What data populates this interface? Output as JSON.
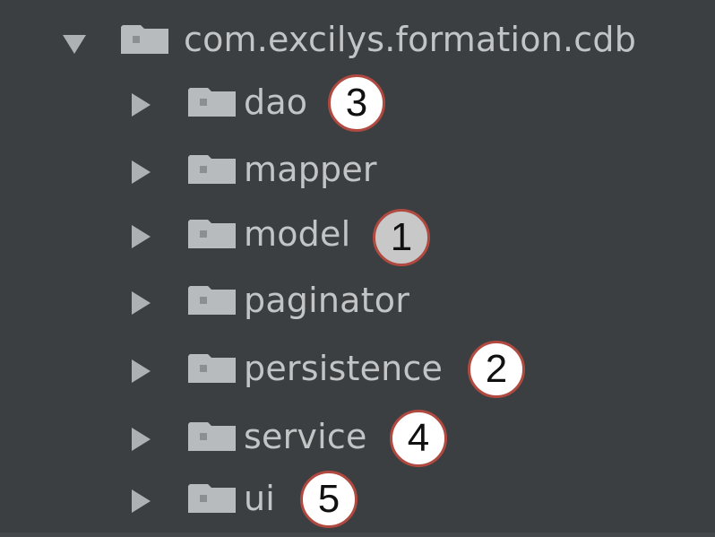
{
  "tree": {
    "root": {
      "label": "com.excilys.formation.cdb",
      "expanded": true,
      "icon": "folder-icon"
    },
    "children": [
      {
        "label": "dao",
        "expanded": false,
        "icon": "folder-icon",
        "annotation": "3"
      },
      {
        "label": "mapper",
        "expanded": false,
        "icon": "folder-icon",
        "annotation": ""
      },
      {
        "label": "model",
        "expanded": false,
        "icon": "folder-icon",
        "annotation": "1"
      },
      {
        "label": "paginator",
        "expanded": false,
        "icon": "folder-icon",
        "annotation": ""
      },
      {
        "label": "persistence",
        "expanded": false,
        "icon": "folder-icon",
        "annotation": "2"
      },
      {
        "label": "service",
        "expanded": false,
        "icon": "folder-icon",
        "annotation": "4"
      },
      {
        "label": "ui",
        "expanded": false,
        "icon": "folder-icon",
        "annotation": "5"
      }
    ]
  },
  "colors": {
    "background": "#3c3f41",
    "text": "#c2c4c6",
    "folder": "#b8bbbd",
    "badge_border": "#b04a40"
  }
}
